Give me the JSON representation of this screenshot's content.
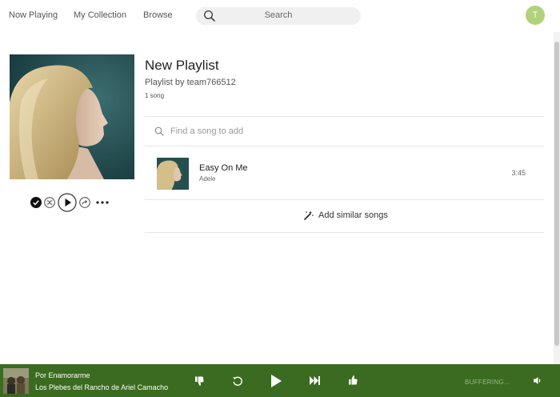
{
  "nav": {
    "links": [
      "Now Playing",
      "My Collection",
      "Browse"
    ],
    "search_label": "Search",
    "search_icon": "magnifier",
    "avatar_initial": "T",
    "avatar_color": "#b2d27a"
  },
  "playlist": {
    "title": "New Playlist",
    "byline": "Playlist by team766512",
    "count": "1 song",
    "controls": [
      "checkmark-icon",
      "shuffle-icon",
      "play-icon",
      "share-icon",
      "more-icon"
    ],
    "find_placeholder": "Find a song to add",
    "songs": [
      {
        "title": "Easy On Me",
        "artist": "Adele",
        "duration": "3:45"
      }
    ],
    "add_similar_label": "Add similar songs"
  },
  "player": {
    "track_title": "Por Enamorarme",
    "track_artist": "Los Plebes del Rancho de Ariel Camacho",
    "status": "BUFFERING...",
    "bar_color": "#3b6b20",
    "controls": [
      "thumbs-down-icon",
      "replay-icon",
      "play-icon",
      "skip-forward-icon",
      "thumbs-up-icon",
      "volume-icon"
    ]
  }
}
